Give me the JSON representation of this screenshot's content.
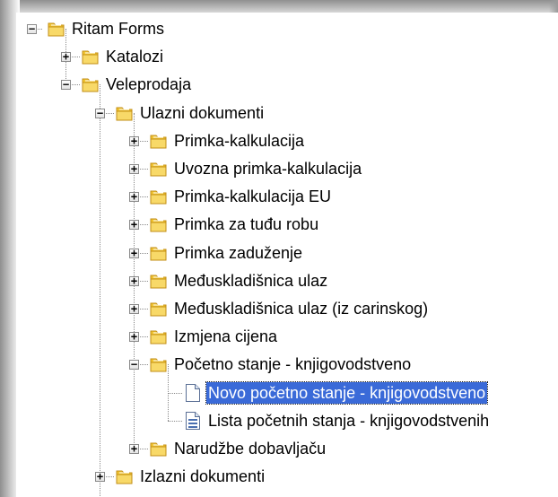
{
  "tree": [
    {
      "label": "Ritam Forms",
      "level": 0,
      "state": "expanded",
      "icon": "folder-icon"
    },
    {
      "label": "Katalozi",
      "level": 1,
      "state": "collapsed",
      "icon": "folder-icon"
    },
    {
      "label": "Veleprodaja",
      "level": 1,
      "state": "expanded",
      "icon": "folder-icon"
    },
    {
      "label": "Ulazni dokumenti",
      "level": 2,
      "state": "expanded",
      "icon": "folder-icon"
    },
    {
      "label": "Primka-kalkulacija",
      "level": 3,
      "state": "collapsed",
      "icon": "folder-icon"
    },
    {
      "label": "Uvozna primka-kalkulacija",
      "level": 3,
      "state": "collapsed",
      "icon": "folder-icon"
    },
    {
      "label": "Primka-kalkulacija EU",
      "level": 3,
      "state": "collapsed",
      "icon": "folder-icon"
    },
    {
      "label": "Primka za tuđu robu",
      "level": 3,
      "state": "collapsed",
      "icon": "folder-icon"
    },
    {
      "label": "Primka zaduženje",
      "level": 3,
      "state": "collapsed",
      "icon": "folder-icon"
    },
    {
      "label": "Međuskladišnica ulaz",
      "level": 3,
      "state": "collapsed",
      "icon": "folder-icon"
    },
    {
      "label": "Međuskladišnica ulaz (iz carinskog)",
      "level": 3,
      "state": "collapsed",
      "icon": "folder-icon"
    },
    {
      "label": "Izmjena cijena",
      "level": 3,
      "state": "collapsed",
      "icon": "folder-icon"
    },
    {
      "label": "Početno stanje - knjigovodstveno",
      "level": 3,
      "state": "expanded",
      "icon": "folder-icon"
    },
    {
      "label": "Novo početno stanje - knjigovodstveno",
      "level": 4,
      "state": "leaf",
      "icon": "blank-document-icon",
      "selected": true
    },
    {
      "label": "Lista početnih stanja - knjigovodstvenih",
      "level": 4,
      "state": "leaf",
      "icon": "list-document-icon"
    },
    {
      "label": "Narudžbe dobavljaču",
      "level": 3,
      "state": "collapsed",
      "icon": "folder-icon"
    },
    {
      "label": "Izlazni dokumenti",
      "level": 2,
      "state": "collapsed",
      "icon": "folder-icon"
    }
  ],
  "colors": {
    "selection": "#3a6ad8",
    "folder": "#f2c531",
    "connector": "#8a8a8a"
  }
}
